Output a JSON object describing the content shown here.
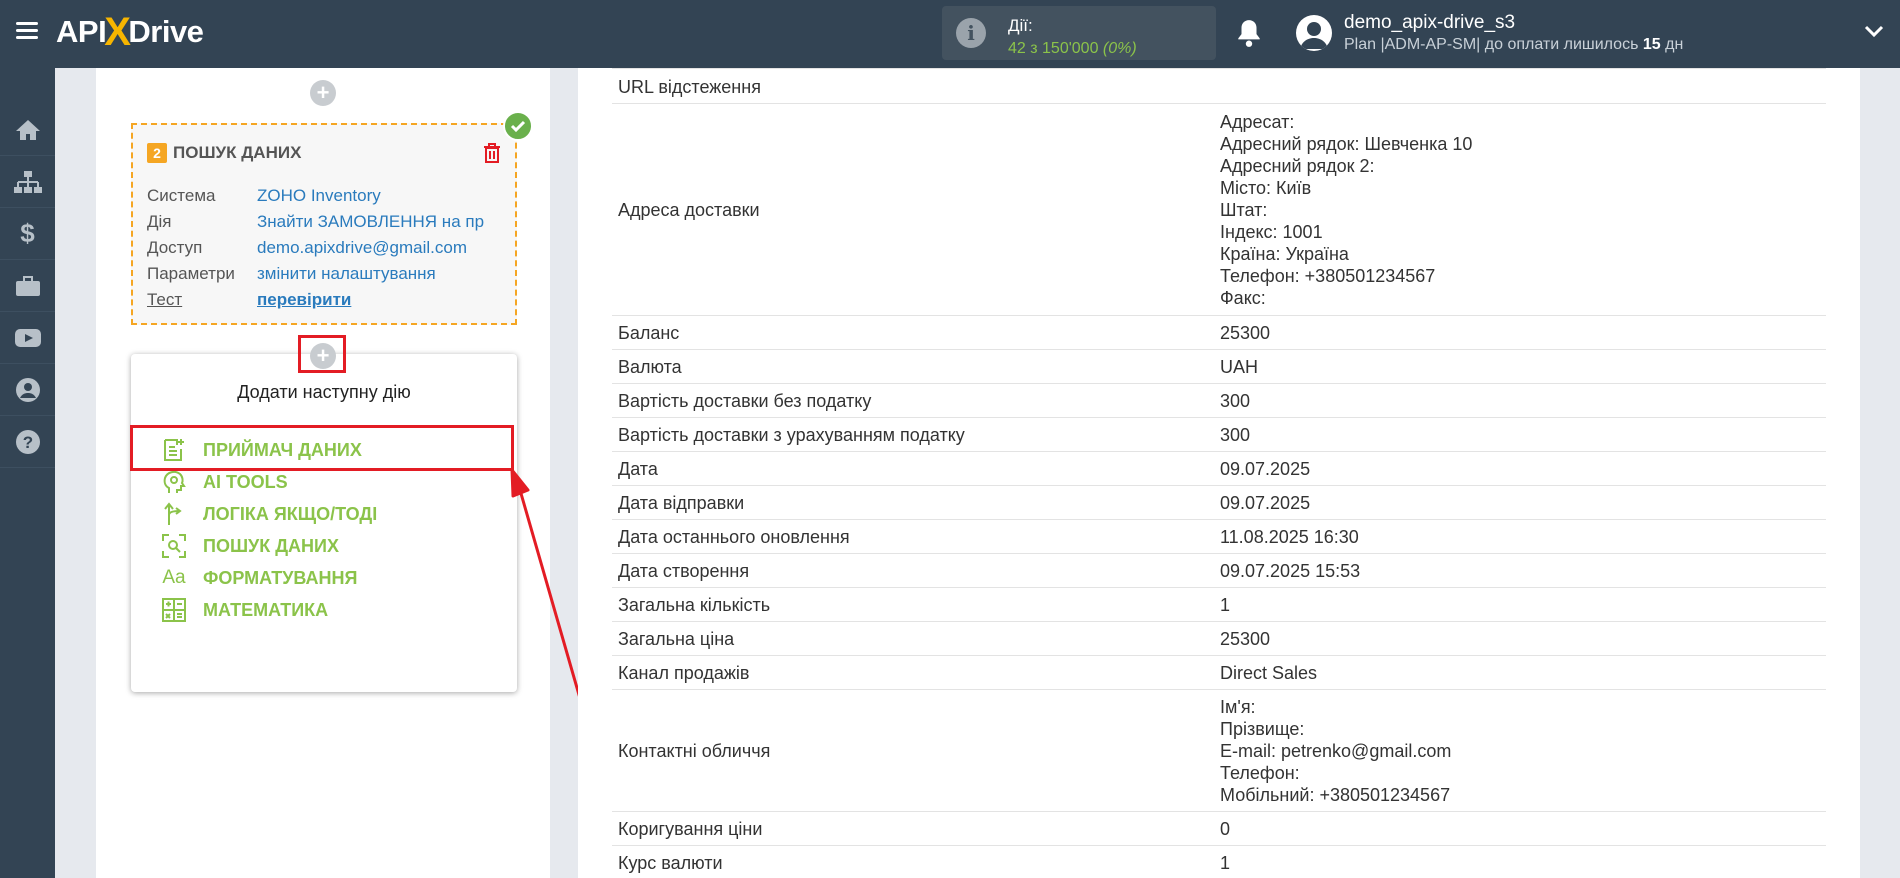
{
  "topbar": {
    "logo_left": "API",
    "logo_x": "X",
    "logo_right": "Drive",
    "actions_label": "Дії:",
    "actions_count": "42 з 150'000",
    "actions_percent": "(0%)",
    "user_name": "demo_apix-drive_s3",
    "plan_text": "Plan |ADM-AP-SM| до оплати лишилось",
    "plan_days": "15",
    "plan_unit": "дн"
  },
  "step": {
    "number": "2",
    "title": "ПОШУК ДАНИХ",
    "rows": [
      {
        "key": "Система",
        "value": "ZOHO Inventory"
      },
      {
        "key": "Дія",
        "value": "Знайти ЗАМОВЛЕННЯ на пр"
      },
      {
        "key": "Доступ",
        "value": "demo.apixdrive@gmail.com"
      },
      {
        "key": "Параметри",
        "value": "змінити налаштування"
      },
      {
        "key": "Тест",
        "value": "перевірити"
      }
    ]
  },
  "popup": {
    "title": "Додати наступну дію",
    "items": [
      {
        "label": "ПРИЙМАЧ ДАНИХ",
        "icon": "document-add-icon"
      },
      {
        "label": "AI TOOLS",
        "icon": "ai-head-icon"
      },
      {
        "label": "ЛОГІКА ЯКЩО/ТОДІ",
        "icon": "branch-icon"
      },
      {
        "label": "ПОШУК ДАНИХ",
        "icon": "scan-search-icon"
      },
      {
        "label": "ФОРМАТУВАННЯ",
        "icon": "font-format-icon"
      },
      {
        "label": "МАТЕМАТИКА",
        "icon": "calculator-icon"
      }
    ]
  },
  "table": [
    {
      "label": "URL відстеження",
      "values": [
        ""
      ]
    },
    {
      "label": "Адреса доставки",
      "values": [
        "Адресат:",
        "Адресний рядок: Шевченка 10",
        "Адресний рядок 2:",
        "Місто: Київ",
        "Штат:",
        "Індекс: 1001",
        "Країна: Україна",
        "Телефон: +380501234567",
        "Факс:"
      ]
    },
    {
      "label": "Баланс",
      "values": [
        "25300"
      ]
    },
    {
      "label": "Валюта",
      "values": [
        "UAH"
      ]
    },
    {
      "label": "Вартість доставки без податку",
      "values": [
        "300"
      ]
    },
    {
      "label": "Вартість доставки з урахуванням податку",
      "values": [
        "300"
      ]
    },
    {
      "label": "Дата",
      "values": [
        "09.07.2025"
      ]
    },
    {
      "label": "Дата відправки",
      "values": [
        "09.07.2025"
      ]
    },
    {
      "label": "Дата останнього оновлення",
      "values": [
        "11.08.2025 16:30"
      ]
    },
    {
      "label": "Дата створення",
      "values": [
        "09.07.2025 15:53"
      ]
    },
    {
      "label": "Загальна кількість",
      "values": [
        "1"
      ]
    },
    {
      "label": "Загальна ціна",
      "values": [
        "25300"
      ]
    },
    {
      "label": "Канал продажів",
      "values": [
        "Direct Sales"
      ]
    },
    {
      "label": "Контактні обличчя",
      "values": [
        "Ім'я:",
        "Прізвище:",
        "E-mail: petrenko@gmail.com",
        "Телефон:",
        "Мобільний: +380501234567"
      ]
    },
    {
      "label": "Коригування ціни",
      "values": [
        "0"
      ]
    },
    {
      "label": "Курс валюти",
      "values": [
        "1"
      ]
    }
  ],
  "colors": {
    "accent_green": "#8bc34a",
    "brand_dark": "#334454",
    "highlight_red": "#e31c24",
    "dashed_orange": "#f5a623"
  }
}
